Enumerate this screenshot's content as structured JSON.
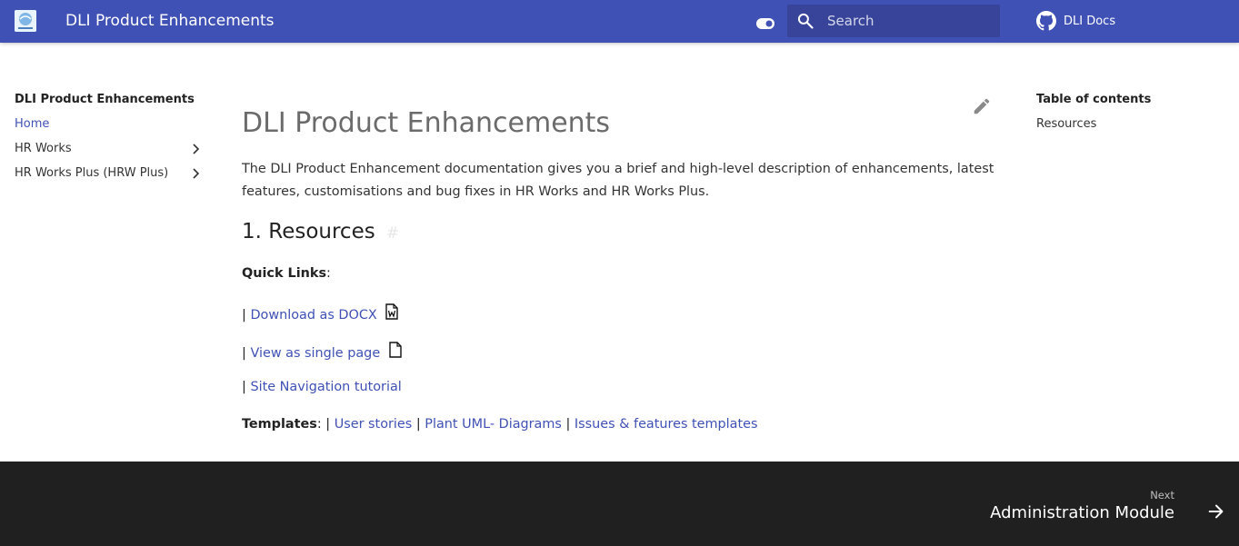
{
  "header": {
    "site_title": "DLI Product Enhancements",
    "search_placeholder": "Search",
    "repo_name": "DLI Docs",
    "accent_color": "#4051b5"
  },
  "nav": {
    "title": "DLI Product Enhancements",
    "items": [
      {
        "label": "Home",
        "active": true,
        "expandable": false
      },
      {
        "label": "HR Works",
        "active": false,
        "expandable": true
      },
      {
        "label": "HR Works Plus (HRW Plus)",
        "active": false,
        "expandable": true
      }
    ]
  },
  "main": {
    "title": "DLI Product Enhancements",
    "intro": "The DLI Product Enhancement documentation gives you a brief and high-level description of enhancements, latest features, customisations and bug fixes in HR Works and HR Works Plus.",
    "section_heading": "1. Resources",
    "heading_anchor": "#",
    "quick_links_label": "Quick Links",
    "pipe": "|",
    "colon": ":",
    "download_docx": "Download as DOCX",
    "single_page": "View as single page",
    "site_nav_tutorial": "Site Navigation tutorial",
    "templates_label": "Templates",
    "templates": [
      "User stories",
      "Plant UML- Diagrams",
      "Issues & features templates"
    ]
  },
  "toc": {
    "title": "Table of contents",
    "items": [
      "Resources"
    ]
  },
  "footer": {
    "next_direction": "Next",
    "next_title": "Administration Module"
  },
  "icons": [
    "logo-icon",
    "theme-toggle-icon",
    "search-icon",
    "github-icon",
    "chevron-right-icon",
    "edit-pencil-icon",
    "word-doc-icon",
    "file-icon",
    "arrow-right-icon"
  ]
}
